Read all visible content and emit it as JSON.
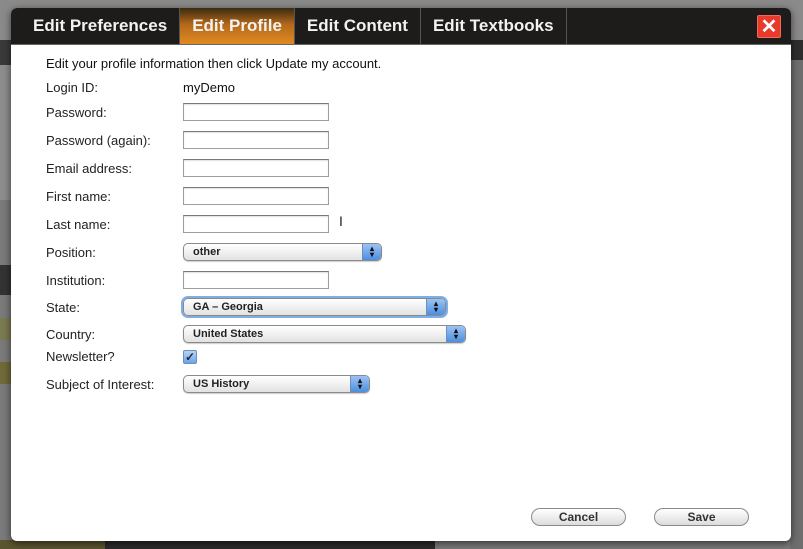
{
  "tabs": [
    {
      "label": "Edit Preferences",
      "active": false
    },
    {
      "label": "Edit Profile",
      "active": true
    },
    {
      "label": "Edit Content",
      "active": false
    },
    {
      "label": "Edit Textbooks",
      "active": false
    }
  ],
  "close_label": "✕",
  "intro": "Edit your profile information then click Update my account.",
  "form": {
    "login_id_label": "Login ID:",
    "login_id_value": "myDemo",
    "password_label": "Password:",
    "password_value": "",
    "password_again_label": "Password (again):",
    "password_again_value": "",
    "email_label": "Email address:",
    "email_value": "",
    "first_name_label": "First name:",
    "first_name_value": "",
    "last_name_label": "Last name:",
    "last_name_value": "",
    "position_label": "Position:",
    "position_value": "other",
    "institution_label": "Institution:",
    "institution_value": "",
    "state_label": "State:",
    "state_value": "GA – Georgia",
    "country_label": "Country:",
    "country_value": "United States",
    "newsletter_label": "Newsletter?",
    "newsletter_checked": true,
    "subject_label": "Subject of Interest:",
    "subject_value": "US History"
  },
  "buttons": {
    "cancel": "Cancel",
    "save": "Save"
  },
  "colors": {
    "active_tab": "#e08a22",
    "close": "#e8392b",
    "tabbar": "#1e1c1b"
  }
}
